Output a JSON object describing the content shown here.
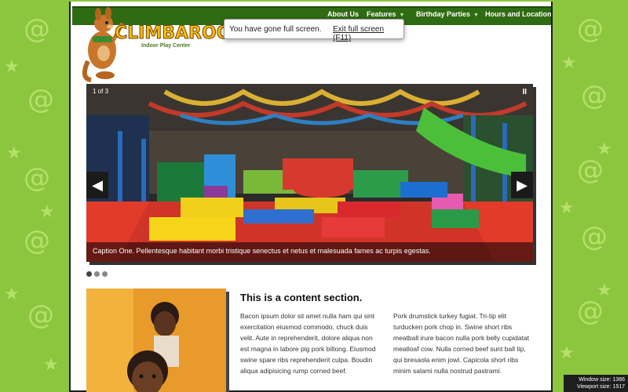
{
  "nav": {
    "items": [
      {
        "label": "About Us",
        "has_caret": false
      },
      {
        "label": "Features",
        "has_caret": true
      },
      {
        "label": "Birthday Parties",
        "has_caret": true
      },
      {
        "label": "Hours and Location",
        "has_caret": false
      }
    ]
  },
  "logo": {
    "name": "CLIMBAROO",
    "tagline": "Indoor Play Center",
    "icon": "kangaroo-mascot-icon"
  },
  "fullscreen_notice": {
    "text": "You have gone full screen.",
    "exit_label": "Exit full screen (F11)"
  },
  "slider": {
    "counter": "1 of 3",
    "pause_icon": "pause-icon",
    "prev_icon": "left-arrow-icon",
    "next_icon": "right-arrow-icon",
    "caption": "Caption One. Pellentesque habitant morbi tristique senectus et netus et malesuada fames ac turpis egestas.",
    "active_index": 0,
    "total": 3
  },
  "content": {
    "title": "This is a content section.",
    "col1": "Bacon ipsum dolor sit amet nulla ham qui sint exercitation eiusmod commodo, chuck duis velit. Aute in reprehenderit, dolore aliqua non est magna in labore pig pork biltong. Eiusmod swine spare ribs reprehenderit culpa. Boudin aliqua adipisicing rump corned beef.",
    "col2": "Pork drumstick turkey fugiat. Tri-tip elit turducken pork chop in. Swine short ribs meatball irure bacon nulla pork belly cupidatat meatloaf cow. Nulla corned beef sunt ball tip, qui bresaola enim jowl. Capicola short ribs minim salami nulla nostrud pastrami."
  },
  "size_badge": {
    "window": "Window size: 1366",
    "viewport": "Viewport size: 1517"
  },
  "colors": {
    "background": "#8cc63f",
    "nav": "#2f6b12",
    "logo_text": "#f2c200"
  }
}
